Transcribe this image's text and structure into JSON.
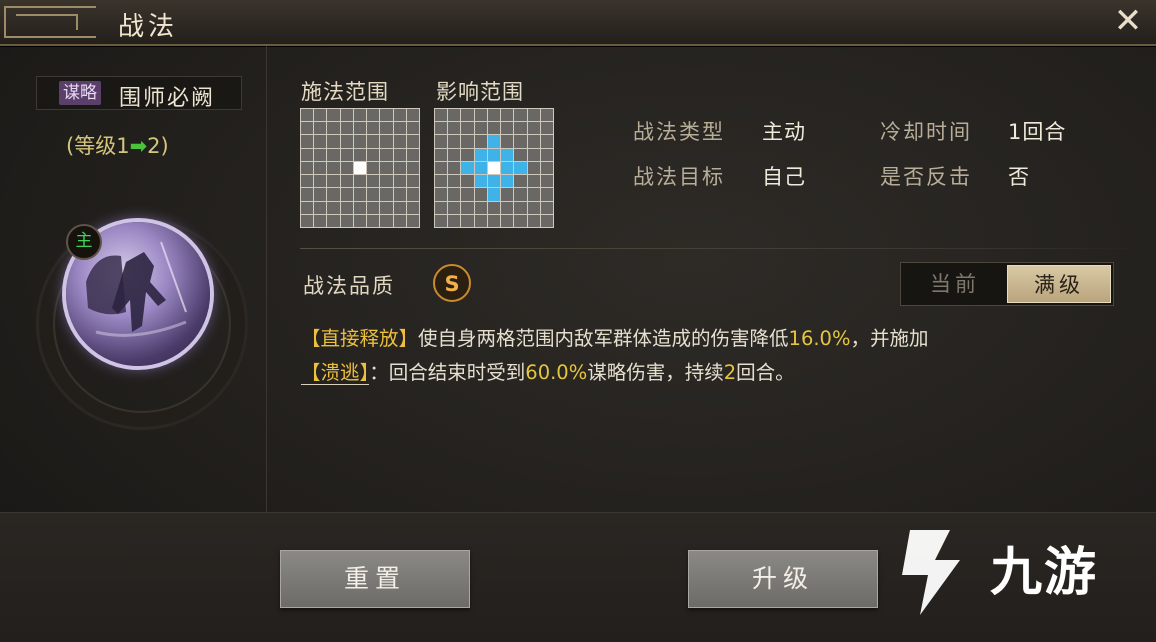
{
  "title": "战法",
  "close_icon": "close-icon",
  "skill": {
    "tag": "谋略",
    "name": "围师必阙",
    "level_prefix": "(等级1",
    "level_arrow": "➡",
    "level_suffix": "2)",
    "badge": "主"
  },
  "grids": {
    "cast_label": "施法范围",
    "effect_label": "影响范围"
  },
  "info": {
    "type_label": "战法类型",
    "type_value": "主动",
    "target_label": "战法目标",
    "target_value": "自己",
    "cooldown_label": "冷却时间",
    "cooldown_value": "1回合",
    "counter_label": "是否反击",
    "counter_value": "否"
  },
  "quality": {
    "label": "战法品质",
    "grade": "S"
  },
  "toggle": {
    "current": "当前",
    "max": "满级",
    "selected": "满级"
  },
  "description": {
    "tag1": "【直接释放】",
    "text1": "使自身两格范围内敌军群体造成的伤害降低",
    "num1": "16.0%",
    "text2": "，并施加",
    "tag2": "【溃逃】",
    "text3": "：回合结束时受到",
    "num2": "60.0%",
    "text4": "谋略伤害，持续",
    "num3": "2",
    "text5": "回合。"
  },
  "buttons": {
    "reset": "重置",
    "upgrade": "升级"
  },
  "watermark": "九游",
  "colors": {
    "highlight": "#e6c53e",
    "area_cell": "#3fb2e8",
    "quality_ring": "#c98b2c"
  }
}
